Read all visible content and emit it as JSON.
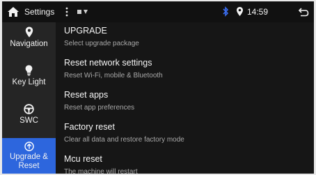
{
  "statusbar": {
    "title": "Settings",
    "time": "14:59",
    "icons": [
      "home-icon",
      "more-vertical-icon",
      "notification-icon",
      "bluetooth-icon",
      "location-icon",
      "back-icon"
    ],
    "bluetooth_color": "#3a6df0"
  },
  "sidebar": {
    "accent": "#2d66dd",
    "items": [
      {
        "label": "Navigation",
        "icon": "location-pin-icon",
        "active": false
      },
      {
        "label": "Key Light",
        "icon": "light-bulb-icon",
        "active": false
      },
      {
        "label": "SWC",
        "icon": "steering-wheel-icon",
        "active": false
      },
      {
        "label": "Upgrade &\nReset",
        "label_line1": "Upgrade &",
        "label_line2": "Reset",
        "icon": "upgrade-arrow-icon",
        "active": true
      }
    ]
  },
  "options": [
    {
      "title": "UPGRADE",
      "subtitle": "Select upgrade package"
    },
    {
      "title": "Reset network settings",
      "subtitle": "Reset Wi-Fi, mobile & Bluetooth"
    },
    {
      "title": "Reset apps",
      "subtitle": "Reset app preferences"
    },
    {
      "title": "Factory reset",
      "subtitle": "Clear all data and restore factory mode"
    },
    {
      "title": "Mcu reset",
      "subtitle": "The machine will restart"
    }
  ]
}
